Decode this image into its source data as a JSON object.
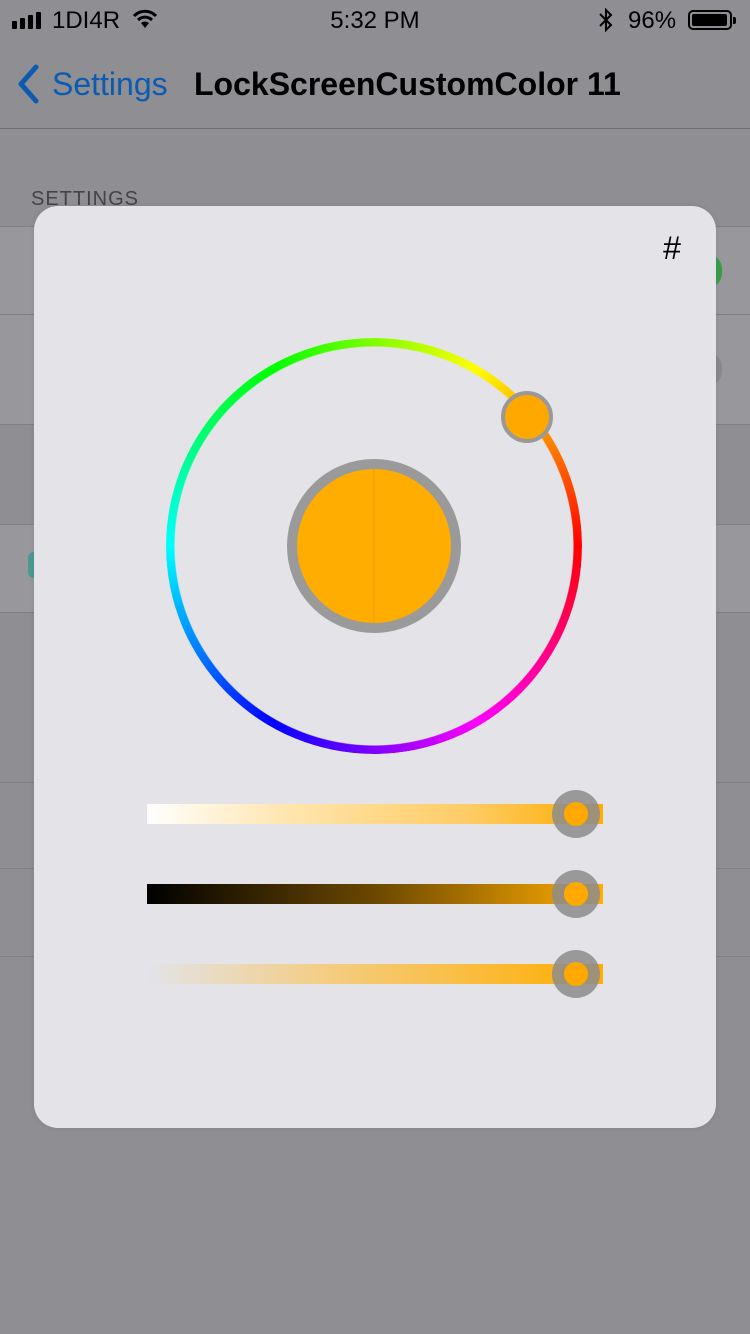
{
  "status_bar": {
    "carrier": "1DI4R",
    "time": "5:32 PM",
    "battery_percent": "96%",
    "battery_level": 0.96,
    "icons": [
      "signal-icon",
      "wifi-icon",
      "bluetooth-icon",
      "battery-icon"
    ]
  },
  "nav": {
    "back_label": "Settings",
    "title": "LockScreenCustomColor 11"
  },
  "background": {
    "section_header": "SETTINGS"
  },
  "picker": {
    "hex_button": "#",
    "selected_color": "#ffad00",
    "hue_degrees": 40,
    "saturation": 0.94,
    "brightness": 0.94,
    "alpha": 0.94
  },
  "colors": {
    "accent": "#0b5bb1",
    "selected": "#ffad00",
    "toggle_on": "#3a9b4a"
  }
}
